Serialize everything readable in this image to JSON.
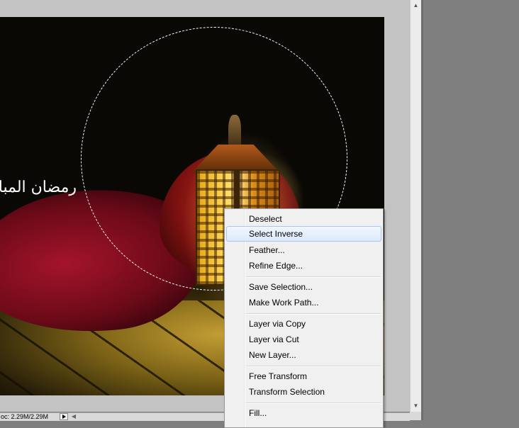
{
  "image": {
    "caption_text": "رمضان المبارك"
  },
  "status_bar": {
    "doc_size": "oc: 2.29M/2.29M"
  },
  "scrollbar": {
    "up_icon": "scroll-up-arrow-icon",
    "down_icon": "scroll-down-arrow-icon",
    "up_glyph": "▲",
    "down_glyph": "▼",
    "left_glyph": "◀"
  },
  "context_menu": {
    "items": [
      {
        "label": "Deselect"
      },
      {
        "label": "Select Inverse",
        "highlighted": true
      },
      {
        "label": "Feather..."
      },
      {
        "label": "Refine Edge..."
      },
      {
        "label": "Save Selection..."
      },
      {
        "label": "Make Work Path..."
      },
      {
        "label": "Layer via Copy"
      },
      {
        "label": "Layer via Cut"
      },
      {
        "label": "New Layer..."
      },
      {
        "label": "Free Transform"
      },
      {
        "label": "Transform Selection"
      },
      {
        "label": "Fill..."
      }
    ]
  },
  "colors": {
    "workspace_bg": "#7f7f7f",
    "menu_bg": "#f0f0f0",
    "menu_highlight": "#dde9fa"
  }
}
